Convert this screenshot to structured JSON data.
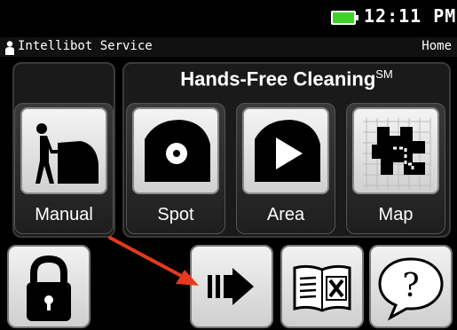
{
  "status": {
    "time": "12:11 PM",
    "battery_color": "#3fd12a"
  },
  "header": {
    "title": "Intellibot Service",
    "home_label": "Home"
  },
  "hands_free": {
    "title": "Hands-Free Cleaning",
    "superscript": "SM"
  },
  "modes": [
    {
      "label": "Manual",
      "icon": "person-pushing-machine-icon"
    },
    {
      "label": "Spot",
      "icon": "spot-cleaning-icon"
    },
    {
      "label": "Area",
      "icon": "area-play-icon"
    },
    {
      "label": "Map",
      "icon": "map-grid-icon"
    }
  ],
  "bottom_buttons": [
    {
      "name": "lock",
      "icon": "padlock-icon"
    },
    {
      "name": "next",
      "icon": "arrow-next-icon"
    },
    {
      "name": "manual",
      "icon": "book-tools-icon"
    },
    {
      "name": "help",
      "icon": "help-bubble-icon",
      "glyph": "?"
    }
  ],
  "annotation": {
    "color": "#e53a1d"
  }
}
